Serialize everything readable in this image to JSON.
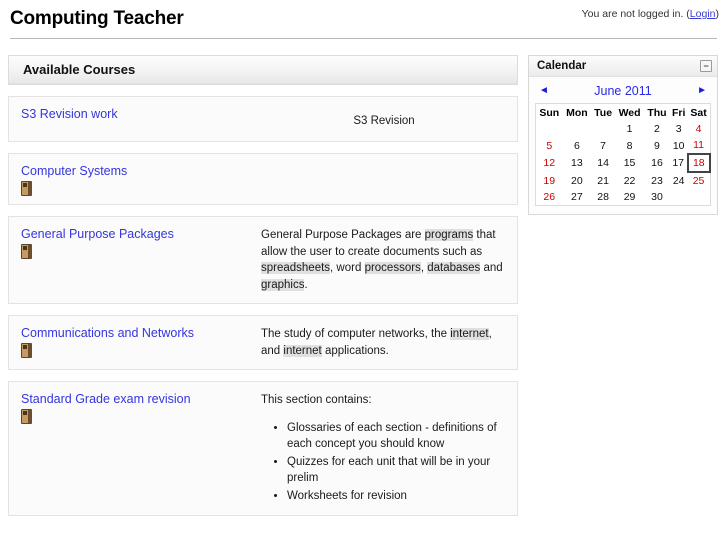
{
  "header": {
    "site_title": "Computing Teacher",
    "login_status": "You are not logged in.",
    "login_open_paren": "(",
    "login_label": "Login",
    "login_close_paren": ")"
  },
  "courses_block": {
    "title": "Available Courses",
    "items": [
      {
        "name": "S3 Revision work",
        "has_summary_icon": false,
        "summary_type": "plain",
        "summary_text": "S3 Revision",
        "summary_align": "center"
      },
      {
        "name": "Computer Systems",
        "has_summary_icon": true,
        "summary_type": "none",
        "summary_text": ""
      },
      {
        "name": "General Purpose Packages",
        "has_summary_icon": true,
        "summary_type": "rich",
        "summary_parts": [
          {
            "text": "General Purpose Packages are ",
            "highlight": false
          },
          {
            "text": "programs",
            "highlight": true
          },
          {
            "text": " that allow the user to create documents such as ",
            "highlight": false
          },
          {
            "text": "spreadsheets",
            "highlight": true
          },
          {
            "text": ", word ",
            "highlight": false
          },
          {
            "text": "processors",
            "highlight": true
          },
          {
            "text": ", ",
            "highlight": false
          },
          {
            "text": "databases",
            "highlight": true
          },
          {
            "text": " and ",
            "highlight": false
          },
          {
            "text": "graphics",
            "highlight": true
          },
          {
            "text": ".",
            "highlight": false
          }
        ]
      },
      {
        "name": "Communications and Networks",
        "has_summary_icon": true,
        "summary_type": "rich",
        "summary_parts": [
          {
            "text": "The study of computer networks, the ",
            "highlight": false
          },
          {
            "text": "internet",
            "highlight": true
          },
          {
            "text": ", and ",
            "highlight": false
          },
          {
            "text": "internet",
            "highlight": true
          },
          {
            "text": " applications.",
            "highlight": false
          }
        ]
      },
      {
        "name": "Standard Grade exam revision",
        "has_summary_icon": true,
        "summary_type": "list",
        "summary_intro": "This section contains:",
        "summary_list": [
          "Glossaries of each section - definitions of each concept you should know",
          "Quizzes for each unit that will be in your prelim",
          "Worksheets for revision"
        ]
      }
    ]
  },
  "calendar_block": {
    "title": "Calendar",
    "minimize_label": "−",
    "prev_arrow": "◄",
    "next_arrow": "►",
    "month_label": "June 2011",
    "weekdays": [
      "Sun",
      "Mon",
      "Tue",
      "Wed",
      "Thu",
      "Fri",
      "Sat"
    ],
    "weekend_columns": [
      0,
      6
    ],
    "today": 18,
    "weeks": [
      [
        "",
        "",
        "",
        "1",
        "2",
        "3",
        "4"
      ],
      [
        "5",
        "6",
        "7",
        "8",
        "9",
        "10",
        "11"
      ],
      [
        "12",
        "13",
        "14",
        "15",
        "16",
        "17",
        "18"
      ],
      [
        "19",
        "20",
        "21",
        "22",
        "23",
        "24",
        "25"
      ],
      [
        "26",
        "27",
        "28",
        "29",
        "30",
        "",
        ""
      ]
    ]
  },
  "colors": {
    "link": "#3535dd",
    "calendar_link": "#2a2ae5",
    "weekend": "#cc0000",
    "highlight_bg": "#e0e0e0",
    "border": "#dcdcdc"
  }
}
